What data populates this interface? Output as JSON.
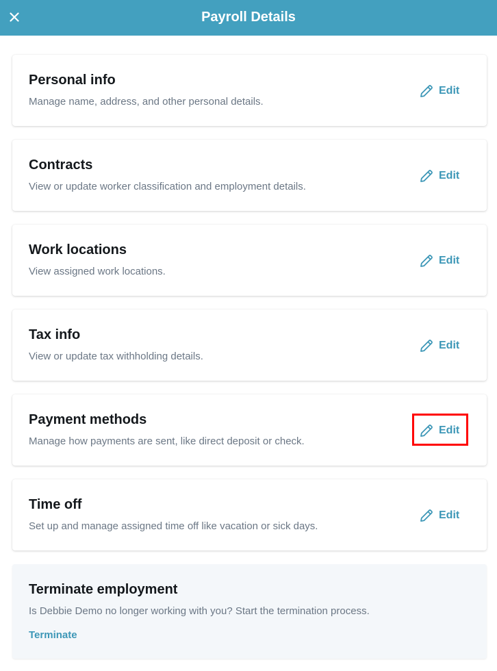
{
  "header": {
    "title": "Payroll Details",
    "close_icon": "close-icon"
  },
  "sections": [
    {
      "title": "Personal info",
      "description": "Manage name, address, and other personal details.",
      "edit_label": "Edit"
    },
    {
      "title": "Contracts",
      "description": "View or update worker classification and employment details.",
      "edit_label": "Edit"
    },
    {
      "title": "Work locations",
      "description": "View assigned work locations.",
      "edit_label": "Edit"
    },
    {
      "title": "Tax info",
      "description": "View or update tax withholding details.",
      "edit_label": "Edit"
    },
    {
      "title": "Payment methods",
      "description": "Manage how payments are sent, like direct deposit or check.",
      "edit_label": "Edit"
    },
    {
      "title": "Time off",
      "description": "Set up and manage assigned time off like vacation or sick days.",
      "edit_label": "Edit"
    }
  ],
  "terminate": {
    "title": "Terminate employment",
    "description": "Is Debbie Demo no longer working with you? Start the termination process.",
    "link_label": "Terminate"
  },
  "colors": {
    "header_bg": "#43a0bf",
    "accent": "#3d97b7",
    "highlight": "#ff0000"
  },
  "icons": {
    "edit": "pencil-icon",
    "close": "close-icon"
  }
}
